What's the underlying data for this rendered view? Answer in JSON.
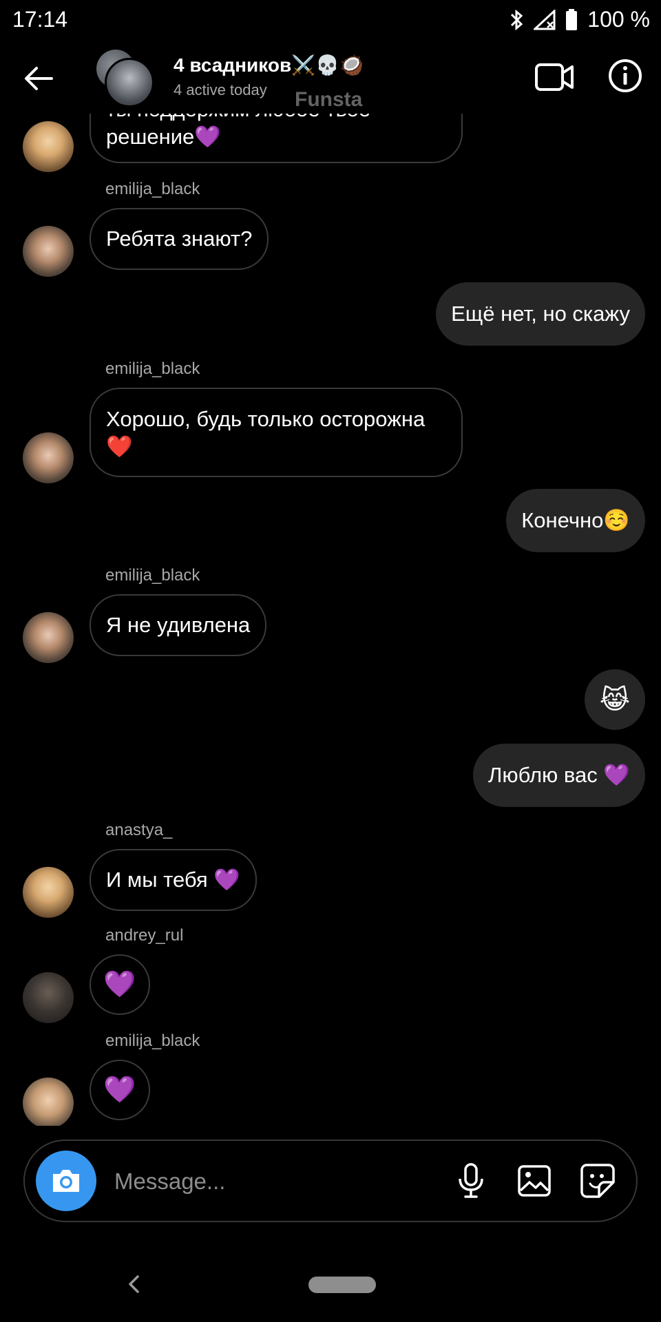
{
  "status_bar": {
    "time": "17:14",
    "battery": "100 %"
  },
  "header": {
    "title": "4 всадников⚔️💀🥥",
    "subtitle": "4 active today",
    "watermark": "Funsta"
  },
  "messages": [
    {
      "type": "in",
      "avatar": "anastya",
      "text": "ты поддержим любое твое решение💜"
    },
    {
      "type": "in",
      "sender": "emilija_black",
      "avatar": "emilija",
      "text": "Ребята знают?"
    },
    {
      "type": "out",
      "text": "Ещё нет, но скажу"
    },
    {
      "type": "in",
      "sender": "emilija_black",
      "avatar": "emilija",
      "text": "Хорошо, будь только осторожна❤️"
    },
    {
      "type": "out",
      "text": "Конечно☺️"
    },
    {
      "type": "in",
      "sender": "emilija_black",
      "avatar": "emilija",
      "text": "Я не удивлена"
    },
    {
      "type": "out-emoji",
      "text": "😹"
    },
    {
      "type": "out",
      "text": "Люблю вас 💜"
    },
    {
      "type": "in",
      "sender": "anastya_",
      "avatar": "anastya",
      "text": "И мы тебя 💜"
    },
    {
      "type": "in-emoji",
      "sender": "andrey_rul",
      "avatar": "andrey",
      "text": "💜"
    },
    {
      "type": "in-emoji",
      "sender": "emilija_black",
      "avatar": "emilija2",
      "text": "💜"
    }
  ],
  "composer": {
    "placeholder": "Message..."
  },
  "colors": {
    "accent": "#3797f0",
    "outgoing_bubble": "#262626",
    "background": "#000000"
  },
  "icons": {
    "back": "arrow-left-icon",
    "video": "video-camera-icon",
    "info": "info-icon",
    "camera": "camera-icon",
    "mic": "microphone-icon",
    "gallery": "image-icon",
    "sticker": "sticker-icon"
  }
}
